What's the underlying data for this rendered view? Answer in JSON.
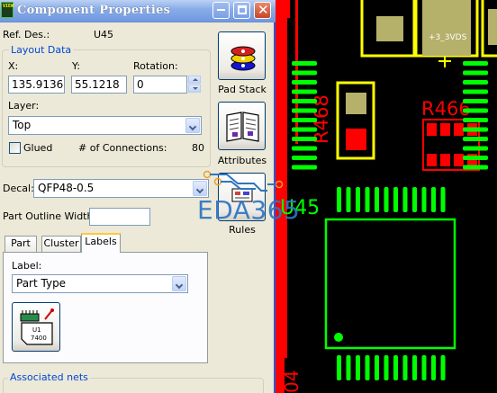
{
  "window": {
    "title": "Component Properties",
    "icon_text": "VIEW"
  },
  "ref_des": {
    "label": "Ref. Des.:",
    "value": "U45"
  },
  "layout_data": {
    "title": "Layout Data",
    "x_label": "X:",
    "x_value": "135.9136",
    "y_label": "Y:",
    "y_value": "55.1218",
    "rotation_label": "Rotation:",
    "rotation_value": "0",
    "layer_label": "Layer:",
    "layer_value": "Top",
    "glued_label": "Glued",
    "glued_checked": false,
    "connections_label": "# of Connections:",
    "connections_value": "80"
  },
  "side_buttons": {
    "pad_stack": "Pad Stack",
    "attributes": "Attributes",
    "rules": "Rules"
  },
  "decal": {
    "label": "Decal:",
    "value": "QFP48-0.5"
  },
  "part_outline": {
    "label": "Part Outline Width:",
    "value": ""
  },
  "tabs": [
    "Part",
    "Cluster",
    "Labels"
  ],
  "active_tab": "Labels",
  "labels_tab": {
    "label_label": "Label:",
    "label_value": "Part Type",
    "icon_button_text": "U1\n7400"
  },
  "associated_nets": {
    "title": "Associated nets"
  },
  "watermark": "EDA365",
  "pcb": {
    "labels": [
      "+3_3VDS",
      "R468",
      "R466",
      "U45",
      "04"
    ],
    "colors": {
      "background": "#000000",
      "outline": "#ffff00",
      "pads_red": "#ff0000",
      "pads_green": "#00ff00",
      "pad_olive": "#b5b06a",
      "track_red": "#ff0000"
    }
  },
  "colors": {
    "dialog_bg": "#ece9d8",
    "group_title": "#0046d5",
    "title_bar": "#7da2e6"
  }
}
